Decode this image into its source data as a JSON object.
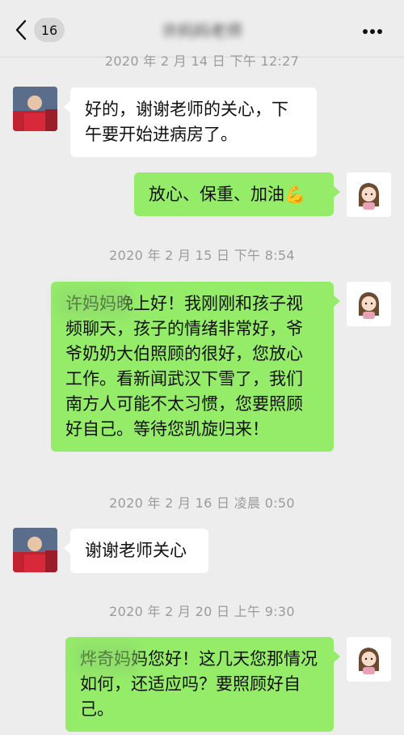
{
  "header": {
    "unread_count": "16",
    "contact_name": "许妈妈老师"
  },
  "messages": [
    {
      "type": "time",
      "text": "2020 年 2 月 14 日 下午 12:27"
    },
    {
      "type": "received",
      "text": "好的，谢谢老师的关心，下午要开始进病房了。"
    },
    {
      "type": "sent",
      "text": "放心、保重、加油💪"
    },
    {
      "type": "time",
      "text": "2020 年 2 月 15 日 下午 8:54"
    },
    {
      "type": "sent",
      "text": "许妈妈晚上好！我刚刚和孩子视频聊天，孩子的情绪非常好，爷爷奶奶大伯照顾的很好，您放心工作。看新闻武汉下雪了，我们南方人可能不太习惯，您要照顾好自己。等待您凯旋归来！"
    },
    {
      "type": "time",
      "text": "2020 年 2 月 16 日 凌晨 0:50"
    },
    {
      "type": "received",
      "text": "谢谢老师关心"
    },
    {
      "type": "time",
      "text": "2020 年 2 月 20 日 上午 9:30"
    },
    {
      "type": "sent",
      "text": "烨奇妈妈您好！这几天您那情况如何，还适应吗？要照顾好自己。"
    }
  ],
  "icons": {
    "back": "chevron-left-icon",
    "more": "more-dots-icon",
    "emoji": "flexed-biceps"
  },
  "colors": {
    "background": "#ededed",
    "sent_bubble": "#95ec69",
    "received_bubble": "#ffffff",
    "timestamp": "#9b9b9b"
  }
}
